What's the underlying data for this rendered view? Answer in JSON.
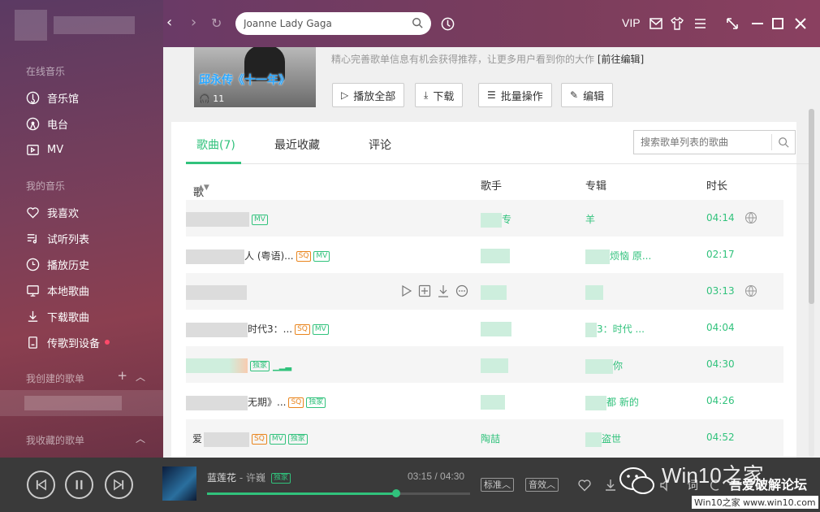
{
  "topbar": {
    "search_value": "Joanne Lady Gaga",
    "vip_label": "VIP"
  },
  "sidebar": {
    "section_online": "在线音乐",
    "online_items": [
      {
        "label": "音乐馆",
        "icon": "music-hall-icon"
      },
      {
        "label": "电台",
        "icon": "radio-icon"
      },
      {
        "label": "MV",
        "icon": "mv-icon"
      }
    ],
    "section_mine": "我的音乐",
    "mine_items": [
      {
        "label": "我喜欢",
        "icon": "heart-icon"
      },
      {
        "label": "试听列表",
        "icon": "playlist-icon"
      },
      {
        "label": "播放历史",
        "icon": "clock-icon"
      },
      {
        "label": "本地歌曲",
        "icon": "monitor-icon"
      },
      {
        "label": "下载歌曲",
        "icon": "download-icon"
      },
      {
        "label": "传歌到设备",
        "icon": "device-icon"
      }
    ],
    "section_created": "我创建的歌单",
    "section_collected": "我收藏的歌单"
  },
  "playlist": {
    "cover_title": "邱永传《十一年》",
    "listen_count": "11",
    "desc": "精心完善歌单信息有机会获得推荐，让更多用户看到你的大作",
    "desc_link": "[前往编辑]",
    "buttons": {
      "play_all": "播放全部",
      "download": "下载",
      "batch": "批量操作",
      "edit": "编辑"
    },
    "tabs": [
      "歌曲(7)",
      "最近收藏",
      "评论"
    ],
    "search_placeholder": "搜索歌单列表的歌曲",
    "columns": {
      "song": "歌曲",
      "singer": "歌手",
      "album": "专辑",
      "duration": "时长"
    },
    "rows": [
      {
        "title_visible": "",
        "tags": [
          "MV"
        ],
        "singer_visible": "专",
        "album_visible": "羊",
        "duration": "04:14",
        "globe": true
      },
      {
        "title_visible": "人 (粤语)...",
        "tags": [
          "SQ",
          "MV"
        ],
        "singer_visible": "",
        "album_visible": "烦恼 原...",
        "duration": "02:17",
        "globe": false
      },
      {
        "title_visible": "",
        "tags": [],
        "singer_visible": "",
        "album_visible": "",
        "duration": "03:13",
        "globe": true,
        "hovered": true
      },
      {
        "title_visible": "时代3：...",
        "tags": [
          "SQ",
          "MV"
        ],
        "singer_visible": "",
        "album_visible": "3：时代 ...",
        "duration": "04:04",
        "globe": false
      },
      {
        "title_visible": "",
        "tags": [
          "独家"
        ],
        "singer_visible": "",
        "album_visible": "你",
        "duration": "04:30",
        "globe": false,
        "playing": true
      },
      {
        "title_visible": "无期》...",
        "tags": [
          "SQ",
          "独家"
        ],
        "singer_visible": "",
        "album_visible": "都 新的",
        "duration": "04:26",
        "globe": false
      },
      {
        "title_visible": "爱",
        "tags": [
          "SQ",
          "MV",
          "独家"
        ],
        "singer_visible": "陶喆",
        "album_visible": "盗世",
        "duration": "04:52",
        "globe": false
      }
    ]
  },
  "player": {
    "song": "蓝莲花",
    "artist": "- 许巍",
    "exclusive_tag": "独家",
    "time_current": "03:15",
    "time_total": "04:30",
    "progress": 0.72,
    "quality_label": "标准",
    "effect_label": "音效",
    "lyrics_label": "词"
  },
  "watermark": {
    "main": "Win10之家",
    "sub": "吾爱破解论坛",
    "url": "Win10之家 www.win10.com"
  },
  "colors": {
    "accent": "#31c27c",
    "sidebar_bg": "#7a3f5a",
    "player_bg": "#3a3a3a"
  }
}
